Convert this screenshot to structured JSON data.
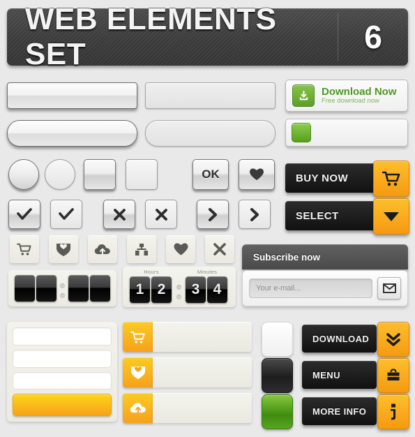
{
  "header": {
    "title": "WEB ELEMENTS SET",
    "number": "6"
  },
  "plain_bars": [
    {
      "name": "bar-rect-dark",
      "style": "rect-dark"
    },
    {
      "name": "bar-rect-light",
      "style": "rect-light"
    },
    {
      "name": "bar-pill-dark",
      "style": "pill-dark"
    },
    {
      "name": "bar-pill-light",
      "style": "pill-light"
    }
  ],
  "download_widget": {
    "icon": "download-tray-icon",
    "title": "Download Now",
    "subtitle": "Free download now",
    "accent_color": "#4e9a22"
  },
  "green_bar": {
    "icon": "green-square-button",
    "accent_color": "#57a01e"
  },
  "action_buttons": [
    {
      "label": "BUY NOW",
      "icon": "shopping-cart-icon",
      "accent_color": "#f7a415"
    },
    {
      "label": "SELECT",
      "icon": "triangle-down-icon",
      "accent_color": "#f7a415"
    }
  ],
  "controls": {
    "circles": [
      {
        "name": "radio-circle-dark"
      },
      {
        "name": "radio-circle-light"
      }
    ],
    "squares": [
      {
        "name": "square-button-dark"
      },
      {
        "name": "square-button-light"
      }
    ],
    "ok_button": {
      "label": "OK"
    },
    "heart_button": {
      "icon": "heart-icon"
    }
  },
  "toggle_row": [
    {
      "icon": "check-icon",
      "style": "dark"
    },
    {
      "icon": "check-icon",
      "style": "light"
    },
    {
      "icon": "cross-icon",
      "style": "dark"
    },
    {
      "icon": "cross-icon",
      "style": "light"
    },
    {
      "icon": "chevron-right-icon",
      "style": "dark"
    },
    {
      "icon": "chevron-right-icon",
      "style": "light"
    }
  ],
  "icon_tiles": [
    {
      "icon": "shopping-cart-icon"
    },
    {
      "icon": "heart-shield-download-icon"
    },
    {
      "icon": "cloud-upload-icon"
    },
    {
      "icon": "sitemap-icon"
    },
    {
      "icon": "heart-icon"
    },
    {
      "icon": "cross-icon"
    }
  ],
  "flip_counters": [
    {
      "name": "blank-flip-counter",
      "groups": [
        {
          "label": "",
          "digits": [
            "",
            ""
          ]
        },
        {
          "label": "",
          "digits": [
            "",
            ""
          ]
        }
      ]
    },
    {
      "name": "time-flip-counter",
      "groups": [
        {
          "label": "Hours",
          "digits": [
            "1",
            "2"
          ]
        },
        {
          "label": "Minutes",
          "digits": [
            "3",
            "4"
          ]
        }
      ]
    }
  ],
  "subscribe": {
    "heading": "Subscribe now",
    "email_value": "",
    "email_placeholder": "Your e-mail...",
    "send_icon": "envelope-icon"
  },
  "form_panel": {
    "fields": [
      {
        "name": "form-field-1",
        "value": "",
        "placeholder": ""
      },
      {
        "name": "form-field-2",
        "value": "",
        "placeholder": ""
      },
      {
        "name": "form-field-3",
        "value": "",
        "placeholder": ""
      }
    ],
    "submit_label": "",
    "submit_color": "#f9a11b"
  },
  "icon_list": [
    {
      "icon": "shopping-cart-icon",
      "text": ""
    },
    {
      "icon": "heart-shield-download-icon",
      "text": ""
    },
    {
      "icon": "cloud-upload-icon",
      "text": ""
    }
  ],
  "big_squares": [
    {
      "name": "big-square-white",
      "color": "#ffffff"
    },
    {
      "name": "big-square-black",
      "color": "#1d1d1d"
    },
    {
      "name": "big-square-green",
      "color": "#3f8c10"
    }
  ],
  "cta_buttons": [
    {
      "label": "DOWNLOAD",
      "icon": "double-chevron-down-icon",
      "accent_color": "#f7a415"
    },
    {
      "label": "MENU",
      "icon": "briefcase-icon",
      "accent_color": "#f7a415"
    },
    {
      "label": "MORE INFO",
      "icon": "info-icon",
      "accent_color": "#f7a415"
    }
  ]
}
